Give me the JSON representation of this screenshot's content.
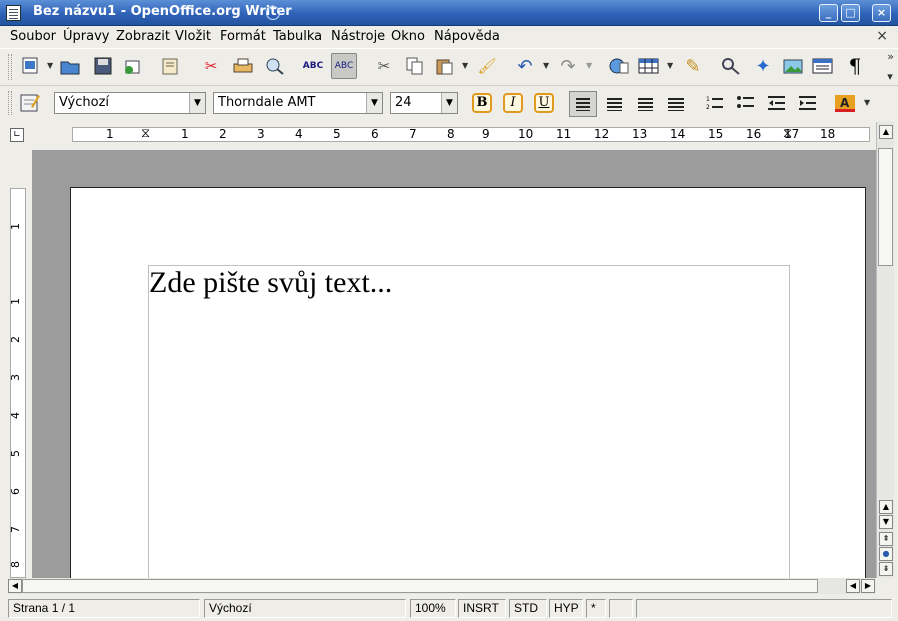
{
  "window": {
    "title": "Bez názvu1 - OpenOffice.org Writer"
  },
  "window_controls": {
    "minimize": "_",
    "maximize": "□",
    "close": "×"
  },
  "menu": [
    "Soubor",
    "Úpravy",
    "Zobrazit",
    "Vložit",
    "Formát",
    "Tabulka",
    "Nástroje",
    "Okno",
    "Nápověda"
  ],
  "menu_close": "×",
  "formatting": {
    "style": "Výchozí",
    "font": "Thorndale AMT",
    "size": "24",
    "bold": "B",
    "italic": "I",
    "underline": "U"
  },
  "ruler": {
    "h_numbers": [
      "1",
      "1",
      "2",
      "3",
      "4",
      "5",
      "6",
      "7",
      "8",
      "9",
      "10",
      "11",
      "12",
      "13",
      "14",
      "15",
      "16",
      "17",
      "18"
    ],
    "v_numbers": [
      "1",
      "1",
      "2",
      "3",
      "4",
      "5",
      "6",
      "7",
      "8"
    ]
  },
  "document": {
    "text": "Zde pište svůj text..."
  },
  "status": {
    "page": "Strana 1 / 1",
    "style": "Výchozí",
    "zoom": "100%",
    "insert_mode": "INSRT",
    "selection_mode": "STD",
    "hyphen": "HYP",
    "modified": "*"
  },
  "icons": [
    "new-document-icon",
    "open-icon",
    "save-icon",
    "email-icon",
    "edit-file-icon",
    "pdf-export-icon",
    "print-icon",
    "page-preview-icon",
    "spellcheck-icon",
    "autospellcheck-icon",
    "cut-icon",
    "copy-icon",
    "paste-icon",
    "format-paintbrush-icon",
    "undo-icon",
    "redo-icon",
    "hyperlink-icon",
    "table-icon",
    "draw-functions-icon",
    "find-replace-icon",
    "navigator-icon",
    "gallery-icon",
    "datasources-icon",
    "nonprinting-chars-icon",
    "stylist-icon",
    "numbering-icon",
    "bullets-icon",
    "decrease-indent-icon",
    "increase-indent-icon",
    "font-color-icon"
  ]
}
